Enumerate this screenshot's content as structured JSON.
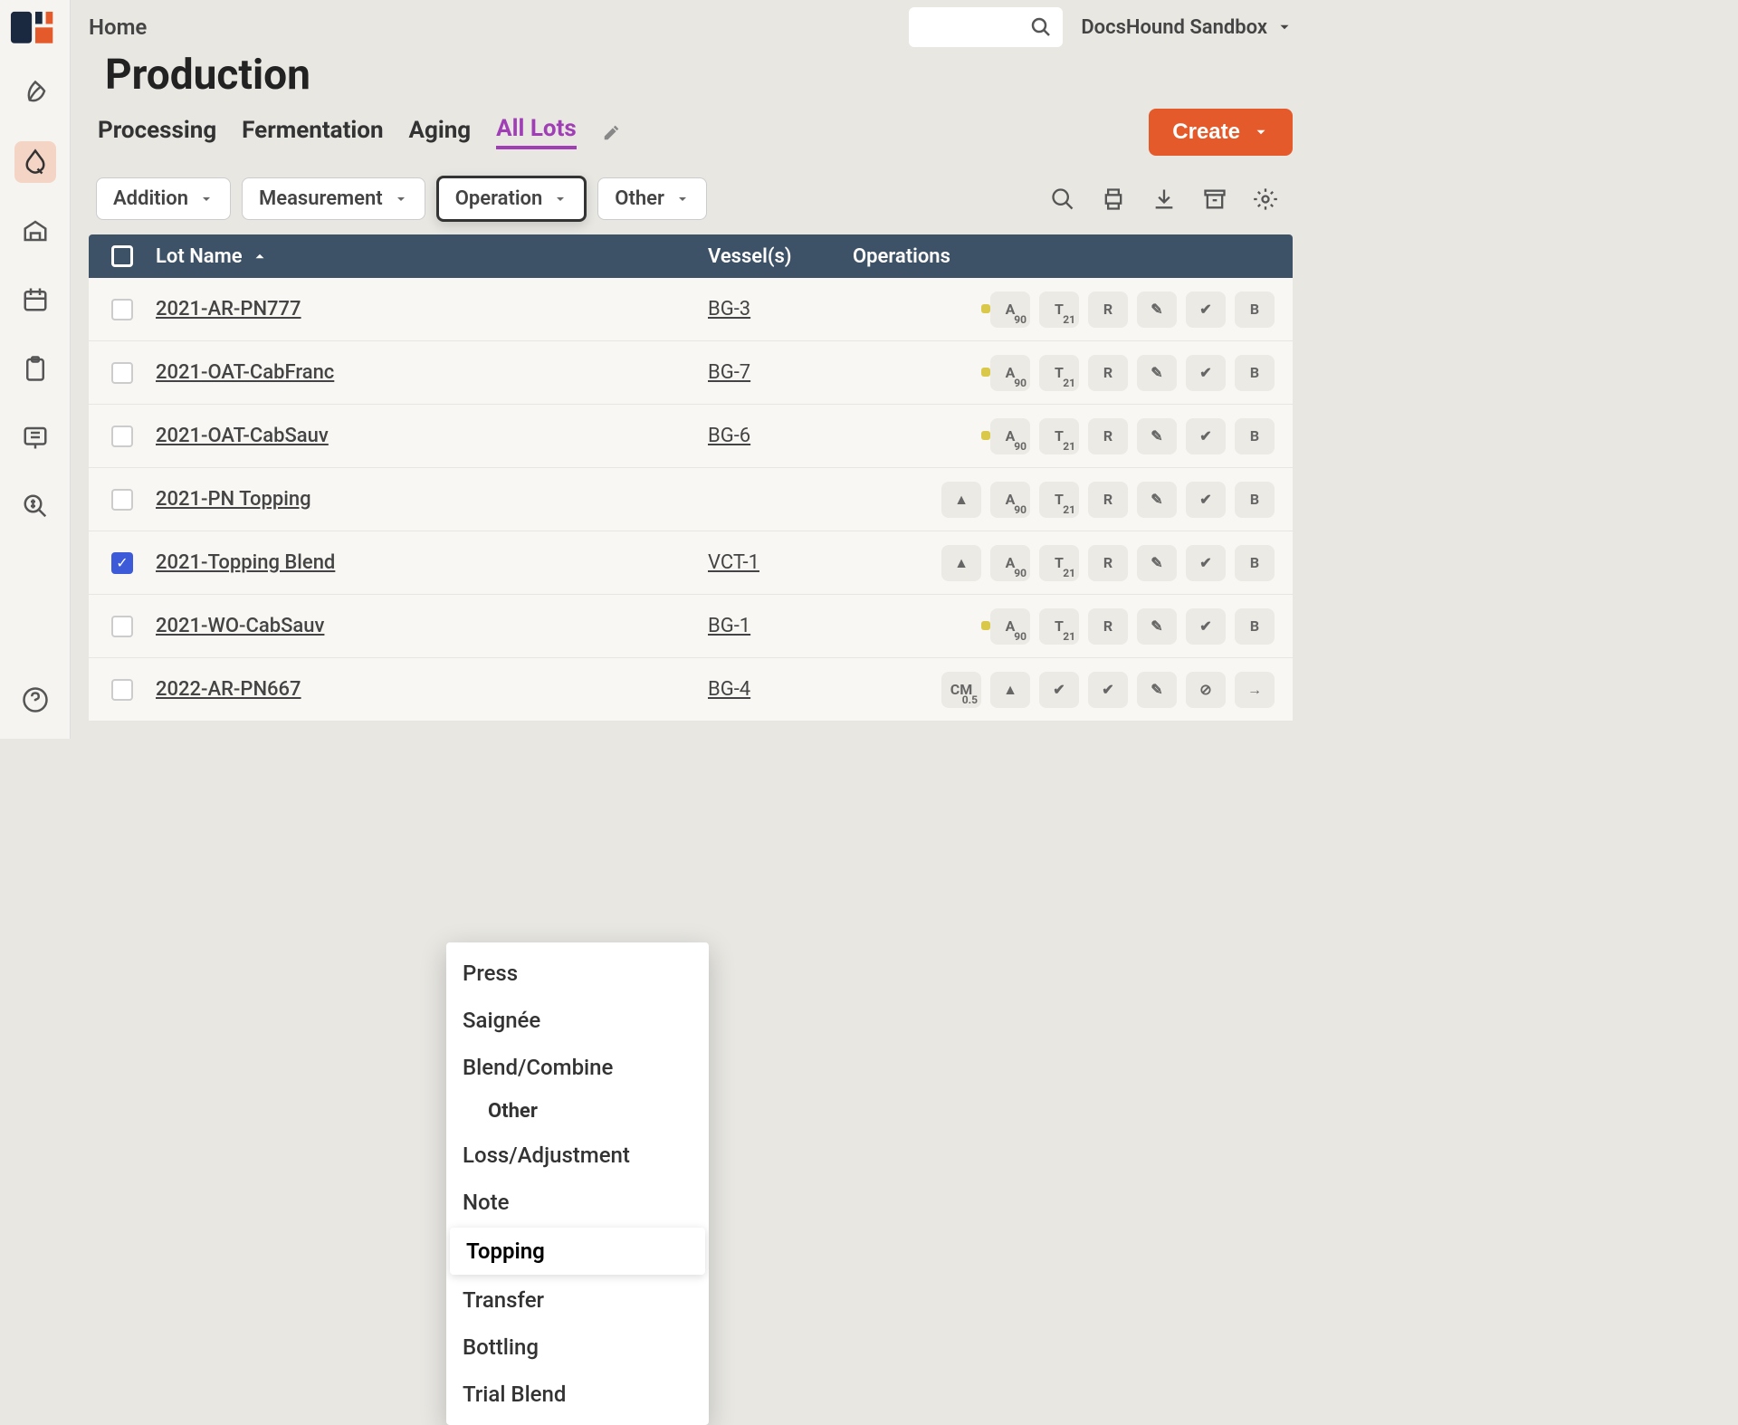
{
  "breadcrumb": "Home",
  "page_title": "Production",
  "account_name": "DocsHound Sandbox",
  "tabs": [
    "Processing",
    "Fermentation",
    "Aging",
    "All Lots"
  ],
  "active_tab_index": 3,
  "create_label": "Create",
  "filters": {
    "addition": "Addition",
    "measurement": "Measurement",
    "operation": "Operation",
    "other": "Other"
  },
  "columns": {
    "lot": "Lot Name",
    "vessel": "Vessel(s)",
    "operations": "Operations"
  },
  "dropdown": {
    "items_top": [
      "Press",
      "Saignée",
      "Blend/Combine"
    ],
    "section_header": "Other",
    "items_mid": [
      "Loss/Adjustment",
      "Note"
    ],
    "highlighted": "Topping",
    "items_bottom": [
      "Transfer",
      "Bottling",
      "Trial Blend"
    ]
  },
  "rows": [
    {
      "lot": "2021-AR-PN777",
      "vessel": "BG-3",
      "checked": false,
      "badges": [
        {
          "t": "A",
          "s": "90",
          "y": true
        },
        {
          "t": "T",
          "s": "21"
        },
        {
          "t": "R"
        },
        {
          "t": "✎"
        },
        {
          "t": "✔"
        },
        {
          "t": "B"
        }
      ]
    },
    {
      "lot": "2021-OAT-CabFranc",
      "vessel": "BG-7",
      "checked": false,
      "badges": [
        {
          "t": "A",
          "s": "90",
          "y": true
        },
        {
          "t": "T",
          "s": "21"
        },
        {
          "t": "R"
        },
        {
          "t": "✎"
        },
        {
          "t": "✔"
        },
        {
          "t": "B"
        }
      ]
    },
    {
      "lot": "2021-OAT-CabSauv",
      "vessel": "BG-6",
      "checked": false,
      "badges": [
        {
          "t": "A",
          "s": "90",
          "y": true
        },
        {
          "t": "T",
          "s": "21"
        },
        {
          "t": "R"
        },
        {
          "t": "✎"
        },
        {
          "t": "✔"
        },
        {
          "t": "B"
        }
      ]
    },
    {
      "lot": "2021-PN Topping",
      "vessel": "",
      "checked": false,
      "badges": [
        {
          "t": "▲"
        },
        {
          "t": "A",
          "s": "90"
        },
        {
          "t": "T",
          "s": "21"
        },
        {
          "t": "R"
        },
        {
          "t": "✎"
        },
        {
          "t": "✔"
        },
        {
          "t": "B"
        }
      ]
    },
    {
      "lot": "2021-Topping Blend",
      "vessel": "VCT-1",
      "checked": true,
      "badges": [
        {
          "t": "▲"
        },
        {
          "t": "A",
          "s": "90"
        },
        {
          "t": "T",
          "s": "21"
        },
        {
          "t": "R"
        },
        {
          "t": "✎"
        },
        {
          "t": "✔"
        },
        {
          "t": "B"
        }
      ]
    },
    {
      "lot": "2021-WO-CabSauv",
      "vessel": "BG-1",
      "checked": false,
      "badges": [
        {
          "t": "A",
          "s": "90",
          "y": true
        },
        {
          "t": "T",
          "s": "21"
        },
        {
          "t": "R"
        },
        {
          "t": "✎"
        },
        {
          "t": "✔"
        },
        {
          "t": "B"
        }
      ]
    },
    {
      "lot": "2022-AR-PN667",
      "vessel": "BG-4",
      "checked": false,
      "badges": [
        {
          "t": "CM",
          "s": "0.5"
        },
        {
          "t": "▲"
        },
        {
          "t": "✔"
        },
        {
          "t": "✔"
        },
        {
          "t": "✎"
        },
        {
          "t": "⊘"
        },
        {
          "t": "→"
        }
      ]
    }
  ]
}
